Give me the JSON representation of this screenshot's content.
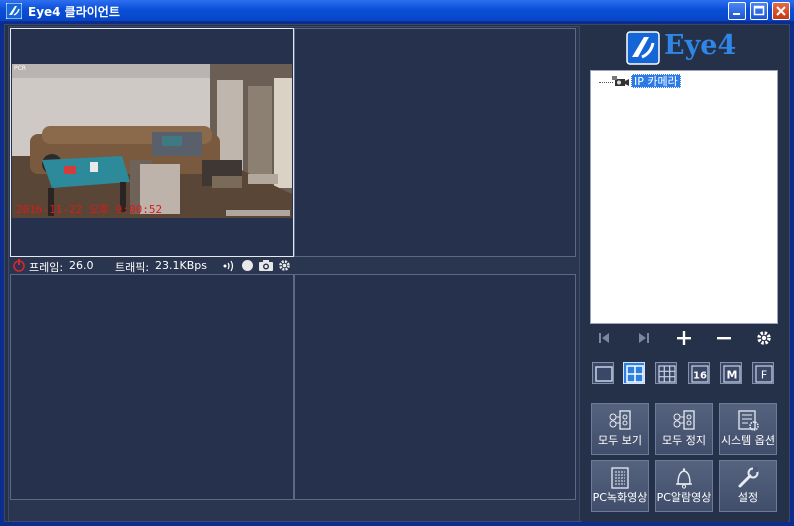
{
  "window": {
    "title": "Eye4 클라이언트",
    "icons": {
      "app": "eye4-app-icon",
      "minimize": "minimize-icon",
      "maximize": "maximize-icon",
      "close": "close-icon"
    }
  },
  "camera_view": {
    "osd_timestamp": "2016-11-22 오후 9:00:52",
    "osd_tag": "PCR"
  },
  "status_bar": {
    "frame_label": "프레임:",
    "frame_value": "26.0",
    "traffic_label": "트래픽:",
    "traffic_value": "23.1KBps",
    "icons": [
      "record-status-icon",
      "audio-icon",
      "record-dot-icon",
      "snapshot-icon",
      "settings-icon"
    ]
  },
  "sidebar": {
    "logo_text": "Eye4",
    "device_tree": [
      {
        "label": "IP 카메라",
        "icon": "camera-icon",
        "selected": true
      }
    ],
    "controls": [
      "first-icon",
      "last-icon",
      "add-icon",
      "remove-icon",
      "gear-icon"
    ],
    "layouts": [
      {
        "id": "1",
        "icon": "layout-1-icon",
        "selected": false
      },
      {
        "id": "4",
        "icon": "layout-4-icon",
        "selected": true
      },
      {
        "id": "9",
        "icon": "layout-9-icon",
        "selected": false
      },
      {
        "id": "16",
        "label": "16",
        "selected": false
      },
      {
        "id": "M",
        "label": "M",
        "selected": false
      },
      {
        "id": "F",
        "label": "F",
        "selected": false
      }
    ],
    "actions": [
      {
        "label": "모두 보기",
        "icon": "view-all-icon"
      },
      {
        "label": "모두 정지",
        "icon": "stop-all-icon"
      },
      {
        "label": "시스템 옵션",
        "icon": "system-options-icon"
      },
      {
        "label": "PC녹화영상",
        "icon": "pc-recording-icon"
      },
      {
        "label": "PC알람영상",
        "icon": "alarm-bell-icon"
      },
      {
        "label": "설정",
        "icon": "wrench-icon"
      }
    ]
  },
  "colors": {
    "panel_bg": "#253049",
    "titlebar": "#0a4fd8",
    "accent": "#2d7fe0",
    "osd_red": "#e01818"
  }
}
